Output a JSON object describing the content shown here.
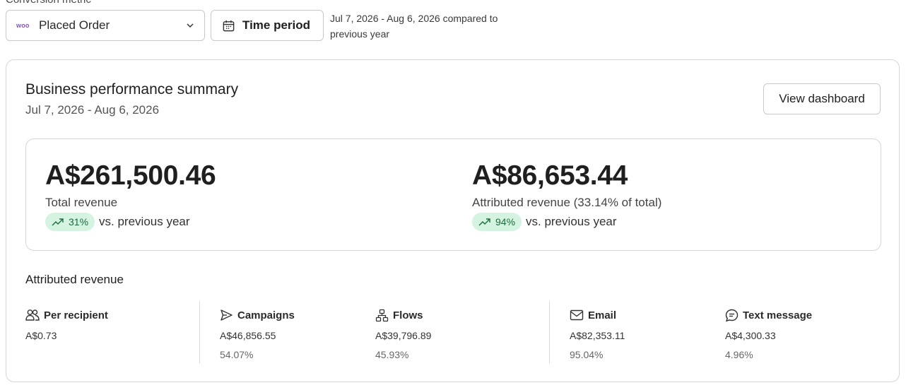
{
  "filters": {
    "metric_label": "Conversion metric",
    "metric_brand": "woo",
    "metric_value": "Placed Order",
    "time_period_label": "Time period",
    "time_period_desc": "Jul 7, 2026 - Aug 6, 2026 compared to previous year"
  },
  "card": {
    "title": "Business performance summary",
    "date_range": "Jul 7, 2026 - Aug 6, 2026",
    "view_dashboard": "View dashboard"
  },
  "summary": {
    "total": {
      "value": "A$261,500.46",
      "label": "Total revenue",
      "change": "31%",
      "compare": "vs. previous year"
    },
    "attributed": {
      "value": "A$86,653.44",
      "label": "Attributed revenue (33.14% of total)",
      "change": "94%",
      "compare": "vs. previous year"
    }
  },
  "attributed": {
    "title": "Attributed revenue",
    "columns": [
      {
        "icon": "people-icon",
        "label": "Per recipient",
        "value": "A$0.73",
        "pct": ""
      },
      {
        "icon": "send-icon",
        "label": "Campaigns",
        "value": "A$46,856.55",
        "pct": "54.07%"
      },
      {
        "icon": "flow-icon",
        "label": "Flows",
        "value": "A$39,796.89",
        "pct": "45.93%"
      },
      {
        "icon": "mail-icon",
        "label": "Email",
        "value": "A$82,353.11",
        "pct": "95.04%"
      },
      {
        "icon": "chat-icon",
        "label": "Text message",
        "value": "A$4,300.33",
        "pct": "4.96%"
      }
    ]
  },
  "colors": {
    "trend_bg": "#d5f3e1",
    "trend_fg": "#1d6b3e",
    "woo_brand": "#7f54b3"
  }
}
